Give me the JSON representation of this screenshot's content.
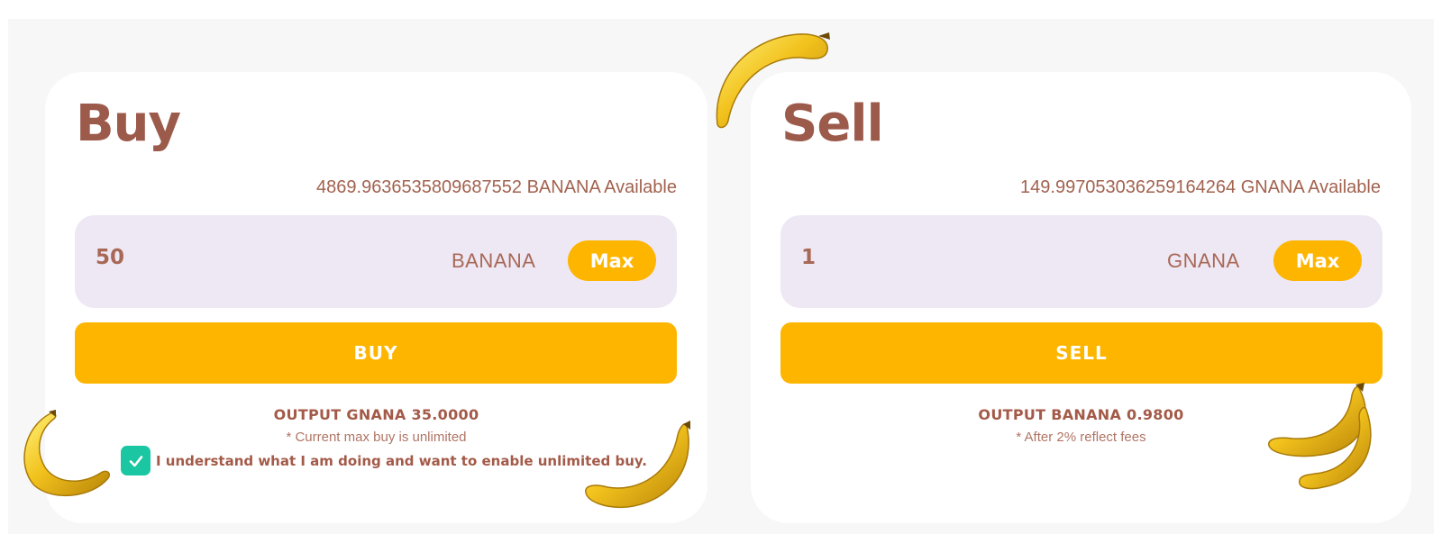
{
  "colors": {
    "accent": "#fdb500",
    "title": "#9c5a4b",
    "input_bg": "#eee7f4",
    "checkbox": "#1bc6a2"
  },
  "buy": {
    "title": "Buy",
    "available": "4869.9636535809687552 BANANA Available",
    "amount": "50",
    "token": "BANANA",
    "max_label": "Max",
    "button_label": "BUY",
    "output": "OUTPUT GNANA 35.0000",
    "note": "* Current max buy is unlimited",
    "confirm_label": "I understand what I am doing and want to enable unlimited buy.",
    "confirm_checked": true
  },
  "sell": {
    "title": "Sell",
    "available": "149.997053036259164264 GNANA Available",
    "amount": "1",
    "token": "GNANA",
    "max_label": "Max",
    "button_label": "SELL",
    "output": "OUTPUT BANANA 0.9800",
    "note": "* After 2% reflect fees"
  },
  "decorations": [
    "banana-icon",
    "banana-bunch-icon"
  ]
}
